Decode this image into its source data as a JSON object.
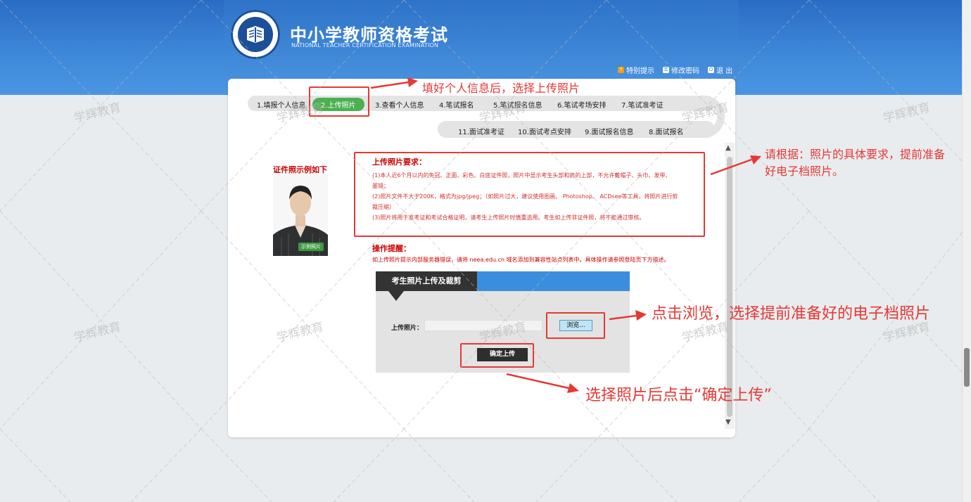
{
  "header": {
    "title": "中小学教师资格考试",
    "subtitle": "NATIONAL TEACHER CERTIFICATION EXAMINATION",
    "links": [
      {
        "label": "特别提示",
        "icon": "help-icon"
      },
      {
        "label": "修改密码",
        "icon": "key-icon"
      },
      {
        "label": "退 出",
        "icon": "exit-icon"
      }
    ]
  },
  "steps": {
    "row1": [
      "1.填报个人信息",
      "2.上传照片",
      "3.查看个人信息",
      "4.笔试报名",
      "5.笔试报名信息",
      "6.笔试考场安排",
      "7.笔试准考证"
    ],
    "row2": [
      "11.面试准考证",
      "10.面试考点安排",
      "9.面试报名信息",
      "8.面试报名"
    ],
    "active": "2.上传照片"
  },
  "sample": {
    "title": "证件照示例如下",
    "badge": "示例照片"
  },
  "requirements": {
    "title": "上传照片要求：",
    "lines": [
      "(1)本人近6个月以内的免冠、正面、彩色、白底证件照，照片中显示考生头部和肩的上部，不允许戴帽子、头巾、发带、",
      "墨镜；",
      "(2)照片文件不大于200K，格式为jpg/jpeg；（如照片过大，建议使用图画、 Photoshop、 ACDsee等工具，将照片进行剪",
      "裁压缩）",
      "(3)照片将用于准考证和考试合格证明，请考生上传照片时慎重选用。考生如上传非证件照，将不能通过审核。"
    ]
  },
  "operation": {
    "title": "操作提醒：",
    "text": "如上传照片提示内部服务器错误，请将 neea.edu.cn 域名添加到兼容性站点列表中。具体操作请参照登陆页下方描述。"
  },
  "upload": {
    "tab_label": "考生照片上传及裁剪",
    "field_label": "上传照片：",
    "file_value": "",
    "browse_label": "浏览...",
    "confirm_label": "确定上传"
  },
  "annotations": {
    "a1": "填好个人信息后，选择上传照片",
    "a2_line1": "请根据：照片的具体要求，提前准备",
    "a2_line2": "好电子档照片。",
    "a3": "点击浏览，选择提前准备好的电子档照片",
    "a4": "选择照片后点击“确定上传”"
  },
  "watermark": "学辉教育",
  "colors": {
    "header_blue": "#3f89da",
    "active_step": "#4caf50",
    "annotation_red": "#e53935",
    "upload_tab_blue": "#3b8ede"
  }
}
